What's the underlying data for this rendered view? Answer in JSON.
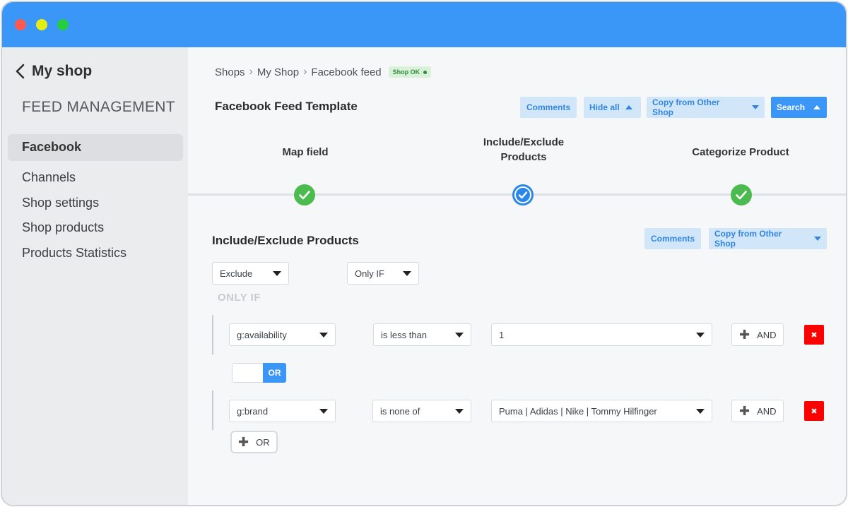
{
  "window": {
    "controls": [
      "close-icon",
      "minimize-icon",
      "maximize-icon"
    ],
    "colors": {
      "titlebar": "#3b97f7",
      "accent": "#3b97f7",
      "success": "#4cbb4f",
      "danger": "#ff0000"
    }
  },
  "sidebar": {
    "back_label": "My shop",
    "section_title": "FEED MANAGEMENT",
    "active_item": "Facebook",
    "items": [
      "Channels",
      "Shop settings",
      "Shop products",
      "Products Statistics"
    ]
  },
  "breadcrumb": {
    "items": [
      "Shops",
      "My Shop",
      "Facebook feed"
    ],
    "badge": "Shop OK"
  },
  "header": {
    "title": "Facebook Feed Template",
    "buttons": {
      "comments": "Comments",
      "hide_all": "Hide all",
      "copy_from": "Copy from Other Shop",
      "search": "Search"
    }
  },
  "steps": [
    {
      "label": "Map field",
      "status": "done"
    },
    {
      "label_line1": "Include/Exclude",
      "label_line2": "Products",
      "status": "current"
    },
    {
      "label": "Categorize Product",
      "status": "done"
    }
  ],
  "section": {
    "title": "Include/Exclude Products",
    "comments": "Comments",
    "copy_from": "Copy from Other Shop",
    "mode_select": "Exclude",
    "condition_select": "Only IF",
    "only_if_label": "ONLY IF"
  },
  "conditions": [
    {
      "field": "g:availability",
      "operator": "is less than",
      "value": "1",
      "and_label": "AND",
      "delete": "✖"
    },
    {
      "field": "g:brand",
      "operator": "is none of",
      "value": "Puma | Adidas | Nike | Tommy Hilfinger",
      "and_label": "AND",
      "delete": "✖"
    }
  ],
  "or_toggle": {
    "label": "OR"
  },
  "add_or": {
    "label": "OR"
  }
}
